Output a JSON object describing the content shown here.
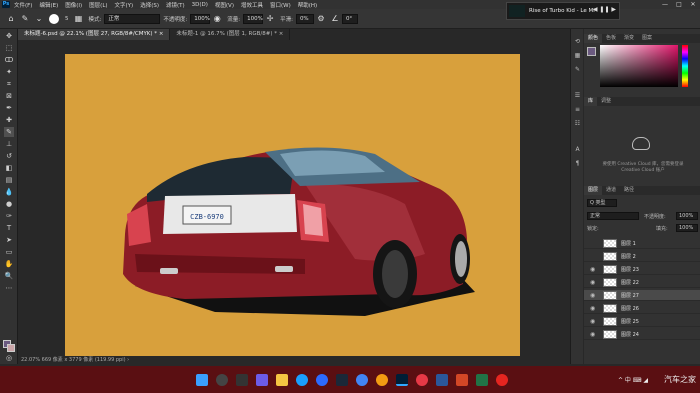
{
  "menu": {
    "app_logo": "Ps",
    "items": [
      "文件(F)",
      "编辑(E)",
      "图像(I)",
      "图层(L)",
      "文字(Y)",
      "选择(S)",
      "滤镜(T)",
      "3D(D)",
      "视图(V)",
      "增效工具",
      "窗口(W)",
      "帮助(H)"
    ],
    "window_controls": [
      "—",
      "□",
      "✕"
    ]
  },
  "options": {
    "size": "5",
    "mode_label": "模式:",
    "mode_value": "正常",
    "opacity_label": "不透明度:",
    "opacity_value": "100%",
    "flow_label": "流量:",
    "flow_value": "100%",
    "smooth_label": "平滑:",
    "smooth_value": "0%",
    "angle_value": "0°"
  },
  "media": {
    "title": "Rise of Turbo Kid - Le Mi",
    "controls": "◀ ❚❚ ▶"
  },
  "tabs": [
    {
      "label": "未标题-6.psd @ 22.1% (图层 27, RGB/8#/CMYK) *",
      "close": "×"
    },
    {
      "label": "未标题-1 @ 16.7% (图层 1, RGB/8#) *",
      "close": "×"
    }
  ],
  "status": {
    "text": "22.07%   669 像素 x 3779 像素 (119.99 ppi)   ›"
  },
  "artwork": {
    "plate": "CZB-6970"
  },
  "panels": {
    "color_tabs": [
      "颜色",
      "色板",
      "渐变",
      "图案"
    ],
    "library_tabs": [
      "库",
      "调整"
    ],
    "cc_text": "要使用 Creative Cloud 库，您需要登录 Creative Cloud 账户",
    "layers_tabs": [
      "图层",
      "通道",
      "路径"
    ],
    "kind_label": "Q 类型",
    "blend_mode": "正常",
    "opacity_label": "不透明度:",
    "opacity_value": "100%",
    "lock_label": "锁定:",
    "fill_label": "填充:",
    "fill_value": "100%",
    "layers": [
      {
        "name": "图层 1",
        "visible": false,
        "selected": false
      },
      {
        "name": "图层 2",
        "visible": false,
        "selected": false
      },
      {
        "name": "图层 23",
        "visible": true,
        "selected": false
      },
      {
        "name": "图层 22",
        "visible": true,
        "selected": false
      },
      {
        "name": "图层 27",
        "visible": true,
        "selected": true
      },
      {
        "name": "图层 26",
        "visible": true,
        "selected": false
      },
      {
        "name": "图层 25",
        "visible": true,
        "selected": false
      },
      {
        "name": "图层 24",
        "visible": true,
        "selected": false
      }
    ]
  },
  "taskbar": {
    "tray": "^   中  ⌨  ◢",
    "watermark": "汽车之家"
  },
  "colors": {
    "artboard": "#d8a03c",
    "car_body": "#8c1c26",
    "taskbar": "#5a0f12",
    "foreground": "#6b5a80",
    "background": "#caa5a8"
  }
}
